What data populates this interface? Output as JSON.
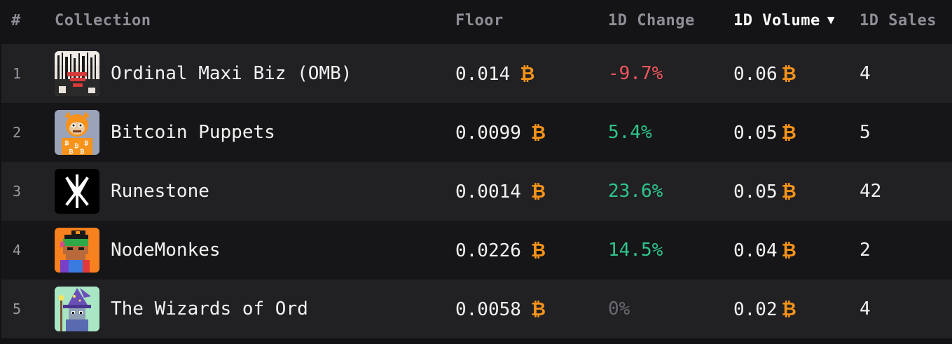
{
  "header": {
    "rank": "#",
    "collection": "Collection",
    "floor": "Floor",
    "change": "1D Change",
    "volume": "1D Volume",
    "sort_indicator": "▼",
    "sales": "1D Sales"
  },
  "currency_symbol": "₿",
  "colors": {
    "accent_btc": "#f7931a",
    "negative": "#f2555c",
    "positive": "#2fc58b",
    "neutral": "#6a6a72"
  },
  "rows": [
    {
      "rank": "1",
      "name": "Ordinal Maxi Biz (OMB)",
      "icon": "omb-collection-icon",
      "floor": "0.014",
      "change": "-9.7%",
      "change_sign": "neg",
      "volume": "0.06",
      "sales": "4"
    },
    {
      "rank": "2",
      "name": "Bitcoin Puppets",
      "icon": "bitcoin-puppets-collection-icon",
      "floor": "0.0099",
      "change": "5.4%",
      "change_sign": "pos",
      "volume": "0.05",
      "sales": "5"
    },
    {
      "rank": "3",
      "name": "Runestone",
      "icon": "runestone-collection-icon",
      "floor": "0.0014",
      "change": "23.6%",
      "change_sign": "pos",
      "volume": "0.05",
      "sales": "42"
    },
    {
      "rank": "4",
      "name": "NodeMonkes",
      "icon": "nodemonkes-collection-icon",
      "floor": "0.0226",
      "change": "14.5%",
      "change_sign": "pos",
      "volume": "0.04",
      "sales": "2"
    },
    {
      "rank": "5",
      "name": "The Wizards of Ord",
      "icon": "wizards-of-ord-collection-icon",
      "floor": "0.0058",
      "change": "0%",
      "change_sign": "zero",
      "volume": "0.02",
      "sales": "4"
    }
  ]
}
